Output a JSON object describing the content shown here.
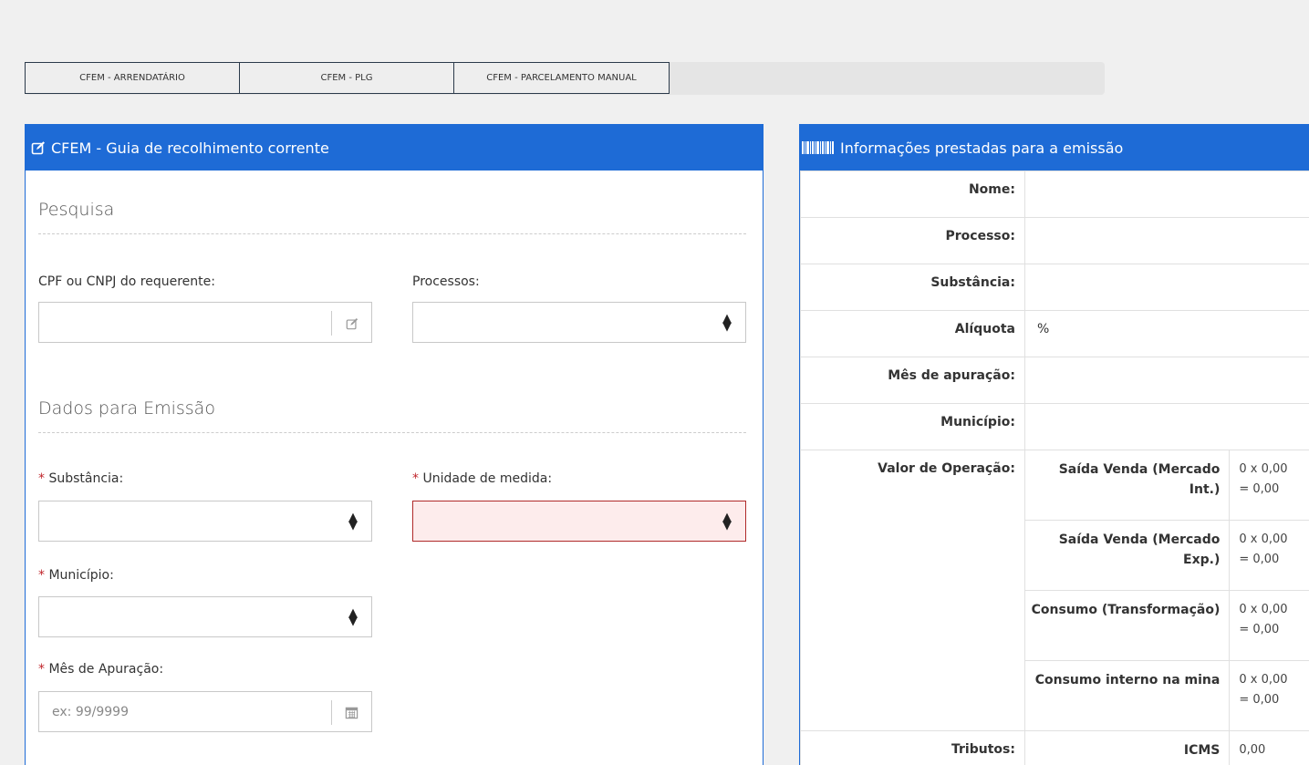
{
  "tabs": [
    {
      "label": "CFEM - ARRENDATÁRIO"
    },
    {
      "label": "CFEM - PLG"
    },
    {
      "label": "CFEM - PARCELAMENTO MANUAL"
    }
  ],
  "left_panel": {
    "title": "CFEM - Guia de recolhimento corrente",
    "search_section": "Pesquisa",
    "cpf_label": "CPF ou CNPJ do requerente:",
    "cpf_value": "",
    "processos_label": "Processos:",
    "processos_value": "",
    "emission_section": "Dados para Emissão",
    "required_mark": "*",
    "substancia_label": "Substância:",
    "unidade_label": "Unidade de medida:",
    "municipio_label": "Município:",
    "mes_label": "Mês de Apuração:",
    "mes_placeholder": "ex: 99/9999"
  },
  "right_panel": {
    "title": "Informações prestadas para a emissão",
    "rows": [
      {
        "key": "Nome:",
        "value": ""
      },
      {
        "key": "Processo:",
        "value": ""
      },
      {
        "key": "Substância:",
        "value": ""
      },
      {
        "key": "Alíquota",
        "value": "%"
      },
      {
        "key": "Mês de apuração:",
        "value": ""
      },
      {
        "key": "Município:",
        "value": ""
      }
    ],
    "valor_label": "Valor de Operação:",
    "operations": [
      {
        "name": "Saída Venda (Mercado Int.)",
        "calc": "0 x 0,00",
        "total": "= 0,00"
      },
      {
        "name": "Saída Venda (Mercado Exp.)",
        "calc": "0 x 0,00",
        "total": "= 0,00"
      },
      {
        "name": "Consumo (Transformação)",
        "calc": "0 x 0,00",
        "total": "= 0,00"
      },
      {
        "name": "Consumo interno na mina",
        "calc": "0 x 0,00",
        "total": "= 0,00"
      }
    ],
    "tributos_label": "Tributos:",
    "tributos": [
      {
        "name": "ICMS",
        "value": "0,00"
      }
    ]
  },
  "colors": {
    "primary": "#1e6bd6",
    "required": "#c0262c",
    "invalid_bg": "#fdecec"
  }
}
